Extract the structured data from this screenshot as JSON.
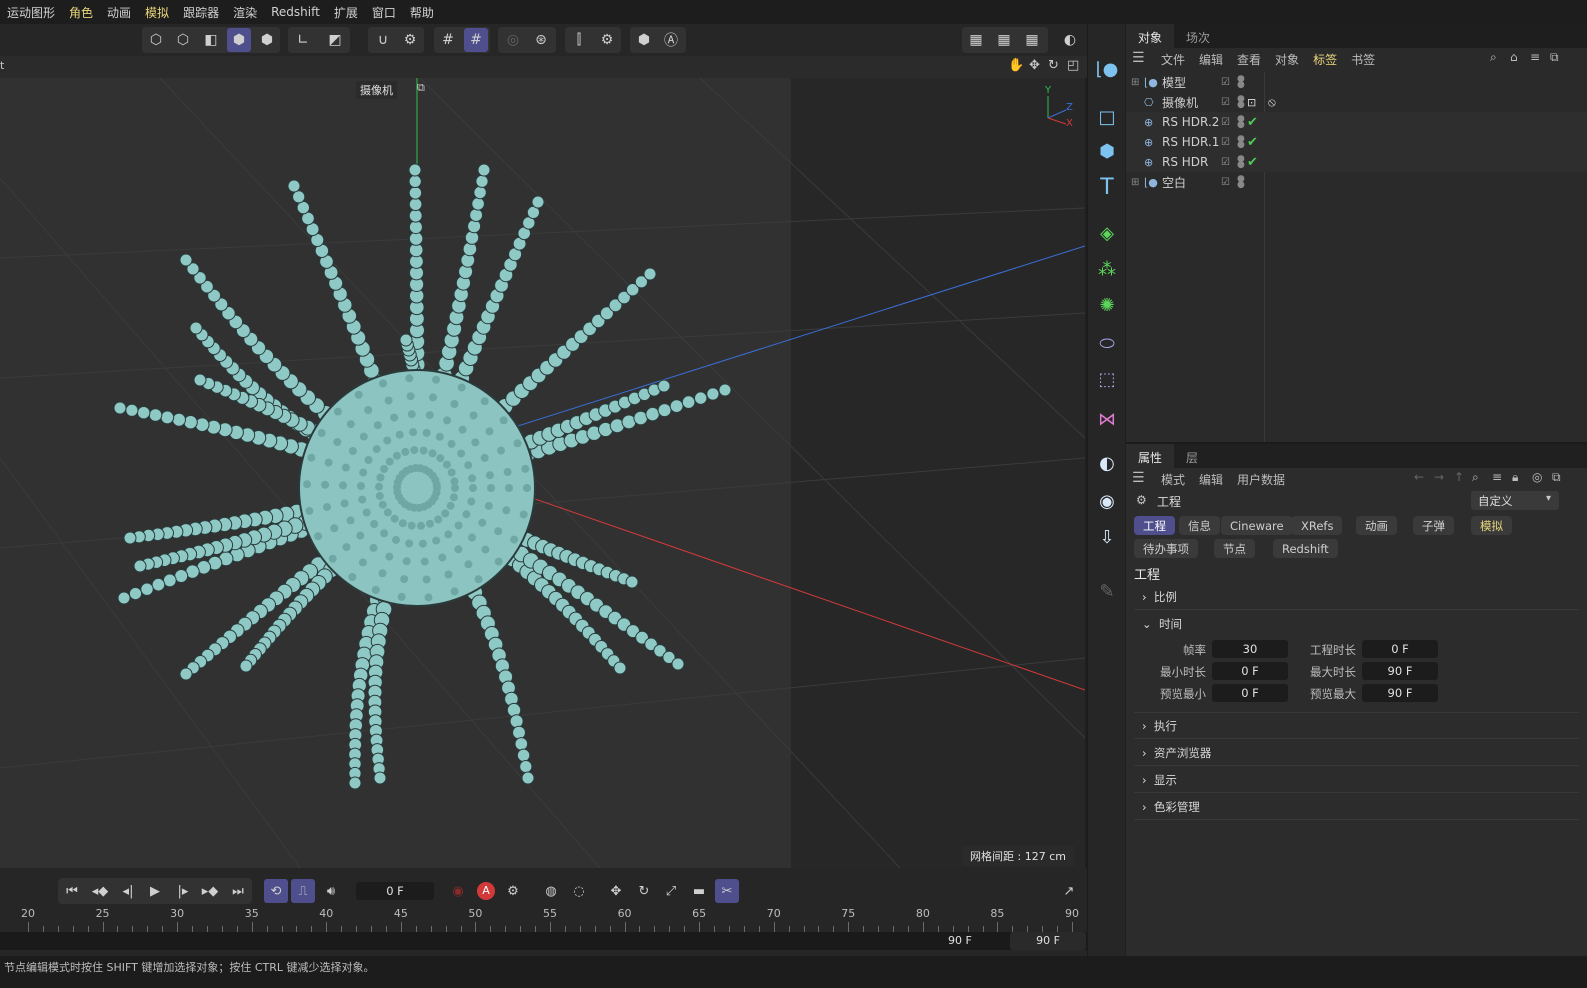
{
  "menu": [
    "运动图形",
    "角色",
    "动画",
    "模拟",
    "跟踪器",
    "渲染",
    "Redshift",
    "扩展",
    "窗口",
    "帮助"
  ],
  "viewport": {
    "camera_label": "摄像机",
    "grid_spacing": "网格间距 : 127 cm",
    "axis": {
      "y": "Y",
      "z": "Z",
      "x": "X"
    },
    "header_left": "t"
  },
  "object_panel": {
    "tabs": [
      "对象",
      "场次"
    ],
    "menu": [
      "文件",
      "编辑",
      "查看",
      "对象",
      "标签",
      "书签"
    ],
    "objects": [
      {
        "name": "模型",
        "icon": "null-icon",
        "tag": ""
      },
      {
        "name": "摄像机",
        "icon": "camera-icon",
        "tag": "target"
      },
      {
        "name": "RS HDR.2",
        "icon": "globe-icon",
        "tag": "check"
      },
      {
        "name": "RS HDR.1",
        "icon": "globe-icon",
        "tag": "check"
      },
      {
        "name": "RS HDR",
        "icon": "globe-icon",
        "tag": "check"
      },
      {
        "name": "空白",
        "icon": "null-icon",
        "tag": ""
      }
    ]
  },
  "attributes": {
    "tabs": [
      "属性",
      "层"
    ],
    "menu": [
      "模式",
      "编辑",
      "用户数据"
    ],
    "object": "工程",
    "preset": "自定义",
    "chips_row1": [
      "工程",
      "信息",
      "Cineware",
      "XRefs",
      "动画",
      "子弹",
      "模拟"
    ],
    "chips_row2": [
      "待办事项",
      "节点",
      "Redshift"
    ],
    "heading": "工程",
    "sections": {
      "scale": "比例",
      "time": "时间",
      "exec": "执行",
      "assets": "资产浏览器",
      "display": "显示",
      "color": "色彩管理"
    },
    "fields": {
      "fps_label": "帧率",
      "fps": "30",
      "projlen_label": "工程时长",
      "projlen": "0 F",
      "min_label": "最小时长",
      "min": "0 F",
      "max_label": "最大时长",
      "max": "90 F",
      "pmin_label": "预览最小",
      "pmin": "0 F",
      "pmax_label": "预览最大",
      "pmax": "90 F"
    }
  },
  "timeline": {
    "current_frame": "0 F",
    "ticks": [
      "20",
      "25",
      "30",
      "35",
      "40",
      "45",
      "50",
      "55",
      "60",
      "65",
      "70",
      "75",
      "80",
      "85",
      "90"
    ],
    "end_label": "90 F",
    "end_field": "90 F"
  },
  "status": "节点编辑模式时按住 SHIFT 键增加选择对象；按住 CTRL 键减少选择对象。"
}
